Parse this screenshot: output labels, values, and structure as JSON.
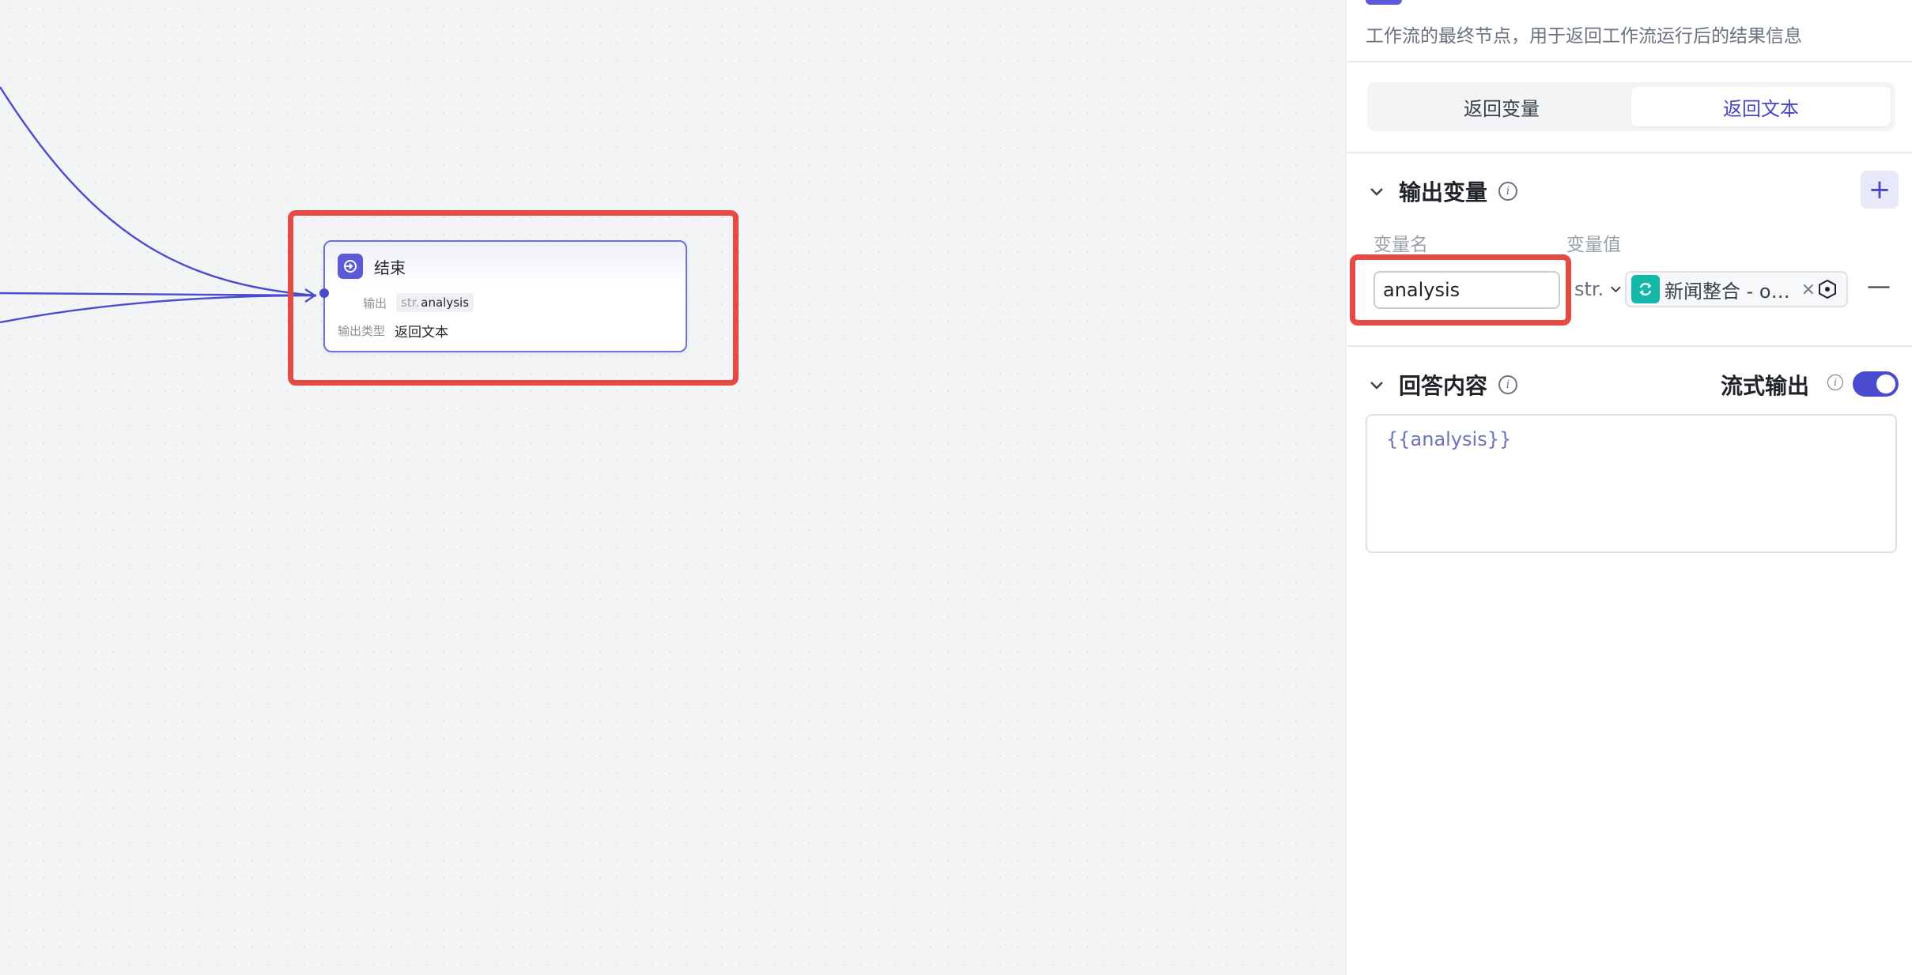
{
  "node": {
    "title": "结束",
    "output_label": "输出",
    "output_type": "str.",
    "output_value": "analysis",
    "type_label": "输出类型",
    "type_value": "返回文本"
  },
  "panel": {
    "description": "工作流的最终节点，用于返回工作流运行后的结果信息",
    "tabs": [
      {
        "label": "返回变量",
        "active": false
      },
      {
        "label": "返回文本",
        "active": true
      }
    ],
    "output_section": {
      "title": "输出变量",
      "col_name": "变量名",
      "col_value": "变量值",
      "variable_name": "analysis",
      "variable_type": "str.",
      "variable_source": "新闻整合 - o…"
    },
    "answer_section": {
      "title": "回答内容",
      "stream_label": "流式输出",
      "stream_enabled": true,
      "content": "{{analysis}}"
    }
  },
  "colors": {
    "accent": "#4b4bd0",
    "highlight": "#e64a45",
    "teal": "#14b8a6"
  }
}
